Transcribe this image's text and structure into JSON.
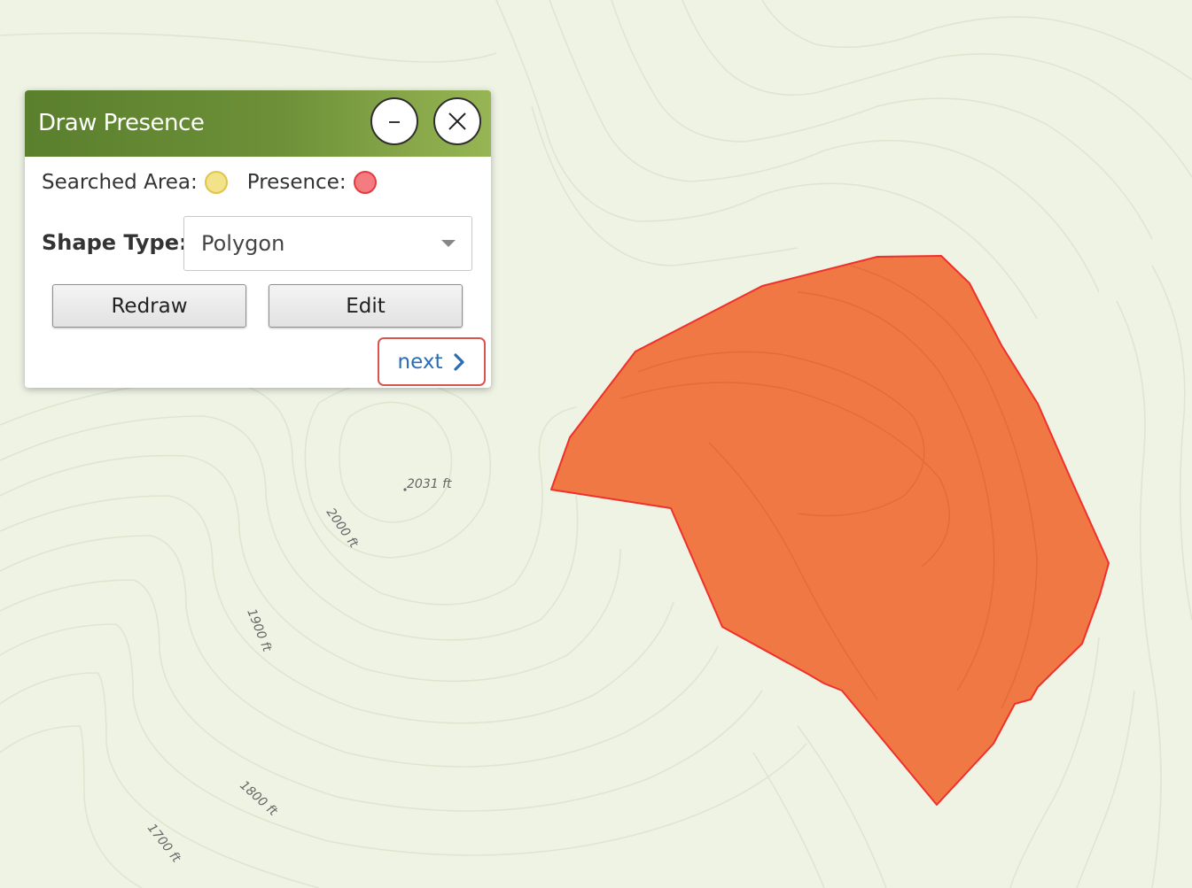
{
  "map": {
    "elevation_labels": {
      "summit": "2031 ft",
      "contour_2000": "2000 ft",
      "contour_1900": "1900 ft",
      "contour_1800": "1800 ft",
      "contour_1700": "1700 ft"
    },
    "presence_polygon_color": "#f0743f",
    "presence_polygon_stroke": "#f0302a",
    "contour_color": "#dfe6cf",
    "background_color": "#eef3e4"
  },
  "panel": {
    "title": "Draw Presence",
    "minimize_icon": "minus-icon",
    "close_icon": "close-icon",
    "legend": {
      "searched_label": "Searched Area:",
      "searched_color": "#f2e38a",
      "presence_label": "Presence:",
      "presence_color": "#f47c80"
    },
    "shape_type_label": "Shape Type:",
    "shape_type_value": "Polygon",
    "redraw_label": "Redraw",
    "edit_label": "Edit",
    "next_label": "next",
    "next_icon": "chevron-right-icon",
    "header_color": "#5a7f2d",
    "link_color": "#2a6db5",
    "highlight_color": "#d9534f"
  }
}
